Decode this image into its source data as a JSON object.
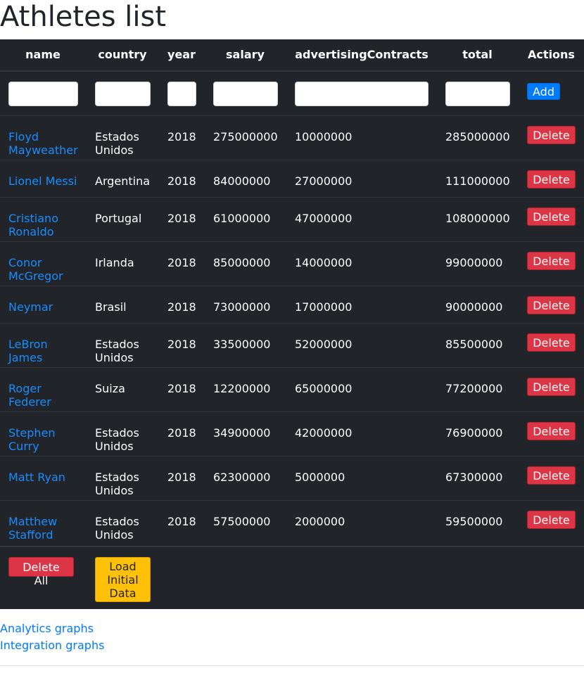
{
  "page": {
    "title": "Athletes list"
  },
  "table": {
    "headers": [
      "name",
      "country",
      "year",
      "salary",
      "advertisingContracts",
      "total",
      "Actions"
    ],
    "add_label": "Add",
    "delete_label": "Delete",
    "rows": [
      {
        "name": "Floyd Mayweather",
        "country": "Estados Unidos",
        "year": "2018",
        "salary": "275000000",
        "ads": "10000000",
        "total": "285000000"
      },
      {
        "name": "Lionel Messi",
        "country": "Argentina",
        "year": "2018",
        "salary": "84000000",
        "ads": "27000000",
        "total": "111000000"
      },
      {
        "name": "Cristiano Ronaldo",
        "country": "Portugal",
        "year": "2018",
        "salary": "61000000",
        "ads": "47000000",
        "total": "108000000"
      },
      {
        "name": "Conor McGregor",
        "country": "Irlanda",
        "year": "2018",
        "salary": "85000000",
        "ads": "14000000",
        "total": "99000000"
      },
      {
        "name": "Neymar",
        "country": "Brasil",
        "year": "2018",
        "salary": "73000000",
        "ads": "17000000",
        "total": "90000000"
      },
      {
        "name": "LeBron James",
        "country": "Estados Unidos",
        "year": "2018",
        "salary": "33500000",
        "ads": "52000000",
        "total": "85500000"
      },
      {
        "name": "Roger Federer",
        "country": "Suiza",
        "year": "2018",
        "salary": "12200000",
        "ads": "65000000",
        "total": "77200000"
      },
      {
        "name": "Stephen Curry",
        "country": "Estados Unidos",
        "year": "2018",
        "salary": "34900000",
        "ads": "42000000",
        "total": "76900000"
      },
      {
        "name": "Matt Ryan",
        "country": "Estados Unidos",
        "year": "2018",
        "salary": "62300000",
        "ads": "5000000",
        "total": "67300000"
      },
      {
        "name": "Matthew Stafford",
        "country": "Estados Unidos",
        "year": "2018",
        "salary": "57500000",
        "ads": "2000000",
        "total": "59500000"
      }
    ],
    "delete_all_label": "Delete All",
    "load_initial_label": "Load Initial Data"
  },
  "links": {
    "analytics": "Analytics graphs",
    "integration": "Integration graphs"
  }
}
